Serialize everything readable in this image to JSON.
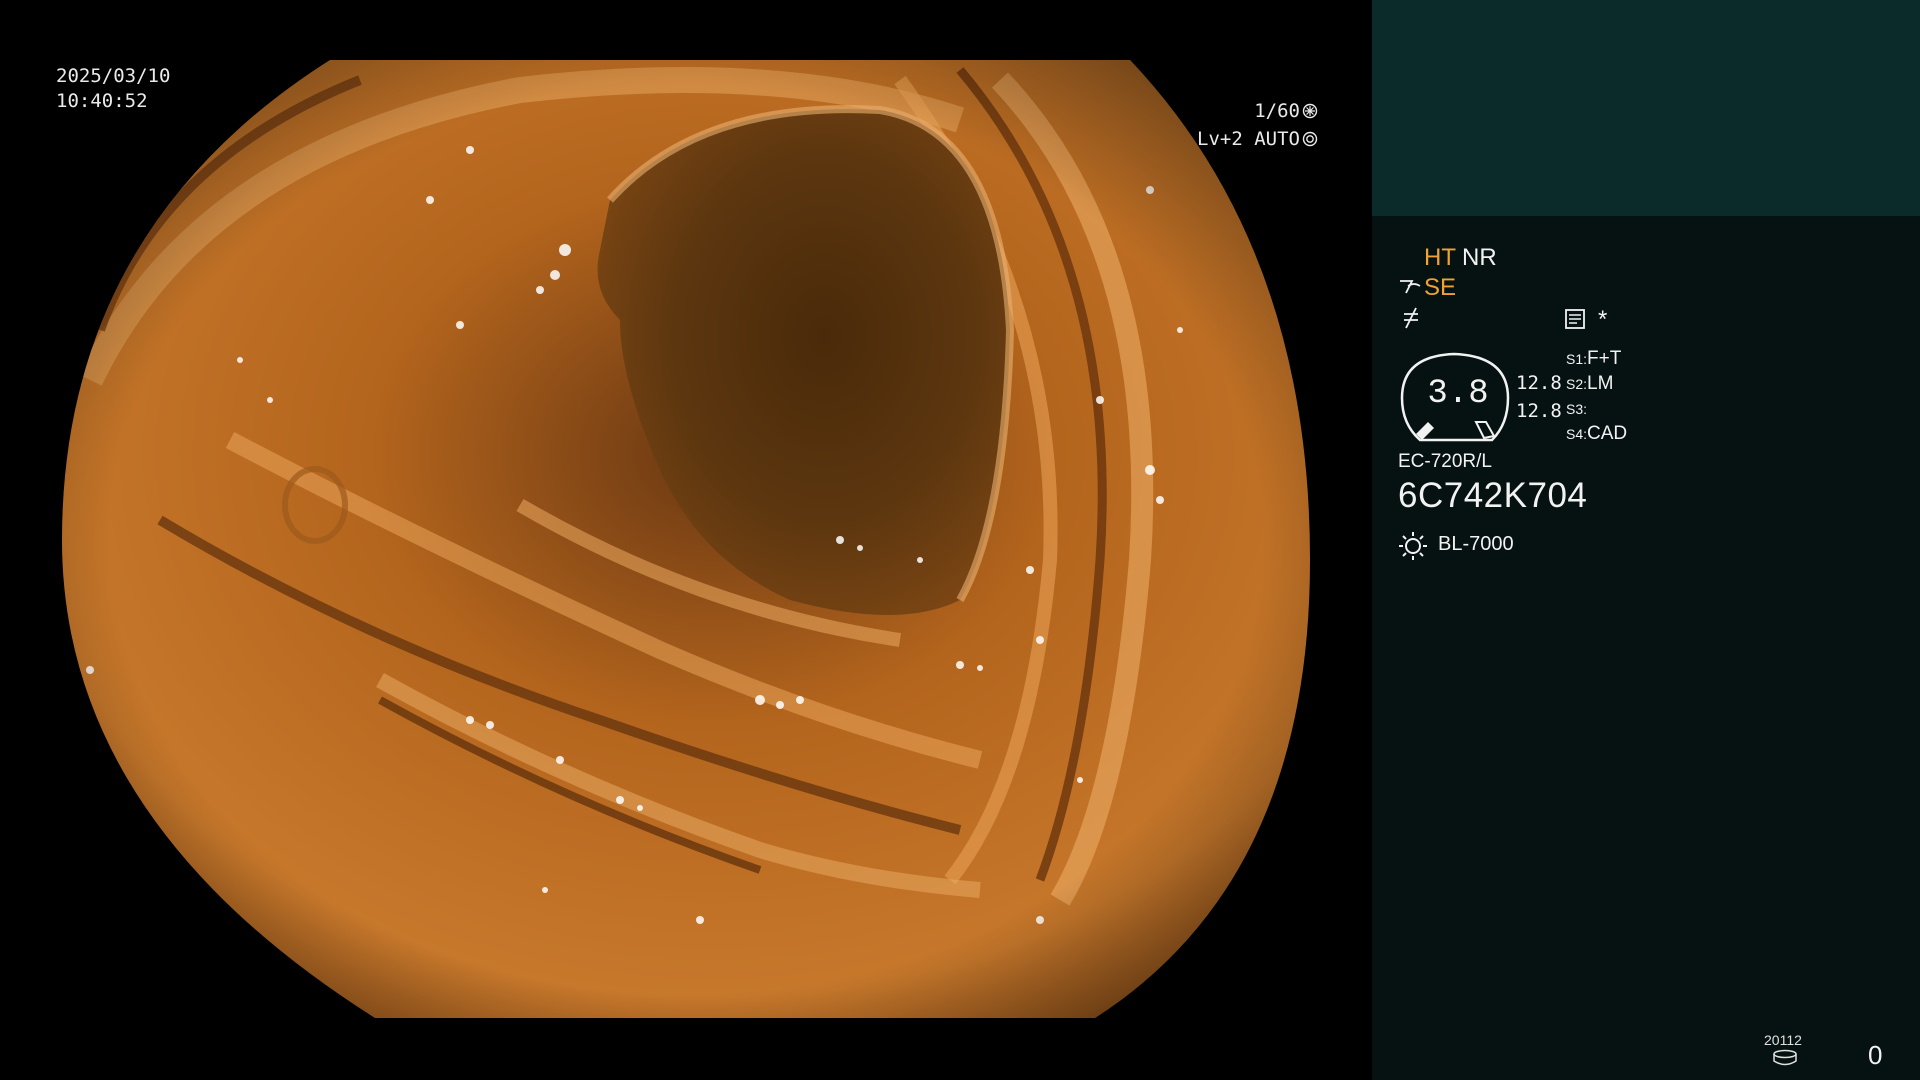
{
  "overlay": {
    "date": "2025/03/10",
    "time": "10:40:52",
    "shutter": "1/60",
    "exposure": "Lv+2 AUTO"
  },
  "info": {
    "modes": {
      "ht": "HT",
      "nr": "NR",
      "se": "SE"
    },
    "asterisk": "*",
    "zoom_value": "3.8",
    "ratio_top": "12.8",
    "ratio_bottom": "12.8",
    "switches": [
      {
        "key": "S1:",
        "value": "F+T"
      },
      {
        "key": "S2:",
        "value": "LM"
      },
      {
        "key": "S3:",
        "value": ""
      },
      {
        "key": "S4:",
        "value": "CAD"
      }
    ],
    "scope_model": "EC-720R/L",
    "scope_serial": "6C742K704",
    "light_source": "BL-7000",
    "record_number": "20112",
    "record_count": "0",
    "colors": {
      "accent": "#f0a232",
      "panel": "#061111",
      "panel_top": "#0b2a2a"
    },
    "icons": [
      "shutter-icon",
      "iris-icon",
      "se-icon",
      "slash-icon",
      "memo-icon",
      "zoom-gauge-icon",
      "light-source-icon",
      "disk-icon"
    ]
  }
}
